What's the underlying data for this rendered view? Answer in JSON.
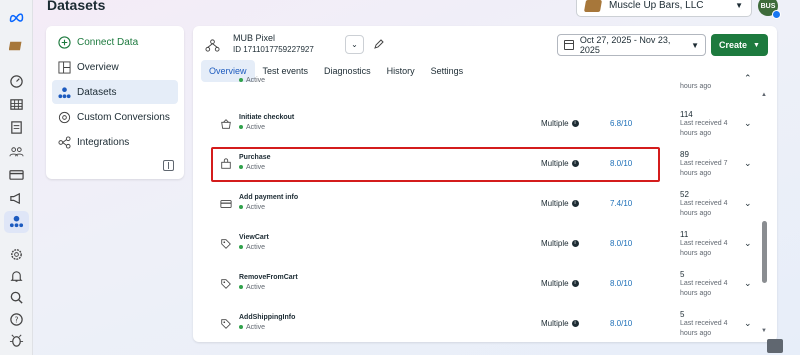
{
  "page_title": "Datasets",
  "business": {
    "name": "Muscle Up Bars, LLC"
  },
  "avatar": {
    "initials": "BUS"
  },
  "left_nav": {
    "connect": "Connect Data",
    "items": [
      {
        "label": "Overview",
        "icon": "overview-icon",
        "active": false
      },
      {
        "label": "Datasets",
        "icon": "datasets-icon",
        "active": true
      },
      {
        "label": "Custom Conversions",
        "icon": "custom-conversions-icon",
        "active": false
      },
      {
        "label": "Integrations",
        "icon": "integrations-icon",
        "active": false
      }
    ]
  },
  "pixel": {
    "name": "MUB Pixel",
    "id": "ID 1711017759227927"
  },
  "date_range": "Oct 27, 2025 - Nov 23, 2025",
  "create_label": "Create",
  "tabs": [
    "Overview",
    "Test events",
    "Diagnostics",
    "History",
    "Settings"
  ],
  "rows": [
    {
      "name": "",
      "status": "Active",
      "integration": "",
      "score": "",
      "count": "",
      "last": "hours ago",
      "partial": true
    },
    {
      "name": "Initiate checkout",
      "status": "Active",
      "integration": "Multiple",
      "score": "6.8/10",
      "count": "114",
      "last": "Last received 4 hours ago"
    },
    {
      "name": "Purchase",
      "status": "Active",
      "integration": "Multiple",
      "score": "8.0/10",
      "count": "89",
      "last": "Last received 7 hours ago"
    },
    {
      "name": "Add payment info",
      "status": "Active",
      "integration": "Multiple",
      "score": "7.4/10",
      "count": "52",
      "last": "Last received 4 hours ago"
    },
    {
      "name": "ViewCart",
      "status": "Active",
      "integration": "Multiple",
      "score": "8.0/10",
      "count": "11",
      "last": "Last received 4 hours ago"
    },
    {
      "name": "RemoveFromCart",
      "status": "Active",
      "integration": "Multiple",
      "score": "8.0/10",
      "count": "5",
      "last": "Last received 4 hours ago"
    },
    {
      "name": "AddShippingInfo",
      "status": "Active",
      "integration": "Multiple",
      "score": "8.0/10",
      "count": "5",
      "last": "Last received 4 hours ago"
    }
  ],
  "colors": {
    "accent_green": "#1d7a3e",
    "link_blue": "#1d6fb8",
    "highlight_red": "#d41c1c",
    "active_dot": "#31a24c"
  }
}
